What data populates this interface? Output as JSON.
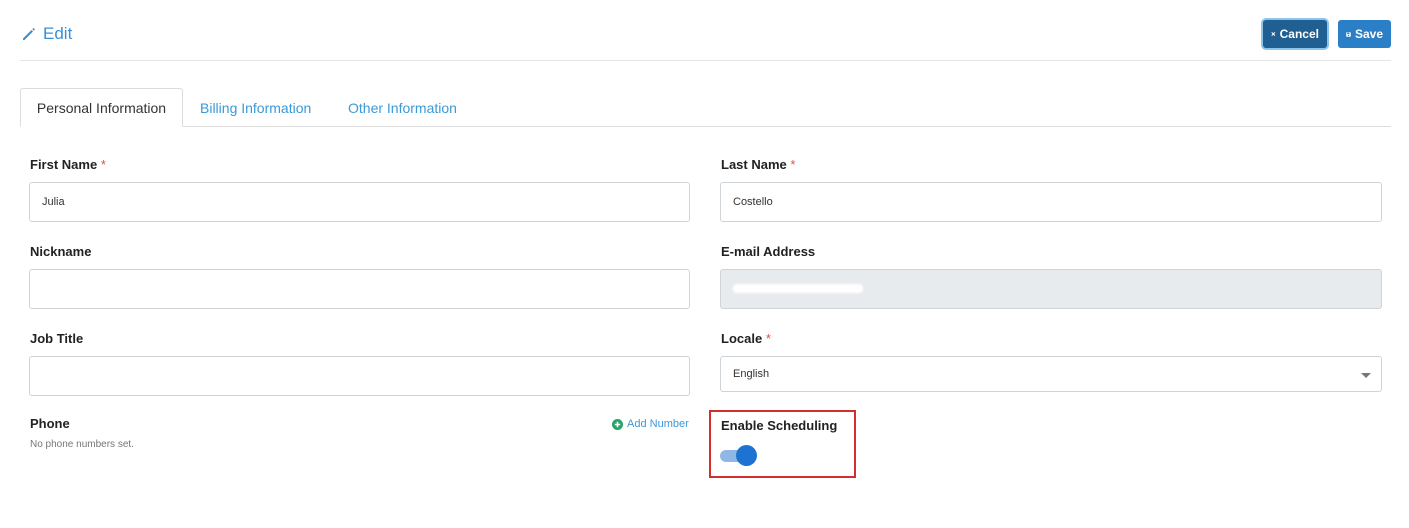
{
  "header": {
    "title": "Edit",
    "cancel_label": "Cancel",
    "save_label": "Save"
  },
  "tabs": [
    {
      "label": "Personal Information",
      "active": true
    },
    {
      "label": "Billing Information",
      "active": false
    },
    {
      "label": "Other Information",
      "active": false
    }
  ],
  "form": {
    "first_name": {
      "label": "First Name",
      "required": "*",
      "value": "Julia"
    },
    "last_name": {
      "label": "Last Name",
      "required": "*",
      "value": "Costello"
    },
    "nickname": {
      "label": "Nickname",
      "value": ""
    },
    "email": {
      "label": "E-mail Address",
      "value": ""
    },
    "job_title": {
      "label": "Job Title",
      "value": ""
    },
    "locale": {
      "label": "Locale",
      "required": "*",
      "value": "English"
    },
    "phone": {
      "label": "Phone",
      "add_label": "Add Number",
      "empty_text": "No phone numbers set."
    },
    "scheduling": {
      "label": "Enable Scheduling",
      "enabled": true
    }
  },
  "colors": {
    "accent": "#2b7fc7",
    "cancel": "#1f5f91",
    "required": "#d9534f",
    "add": "#29a36a",
    "highlight": "#d32f2f"
  }
}
